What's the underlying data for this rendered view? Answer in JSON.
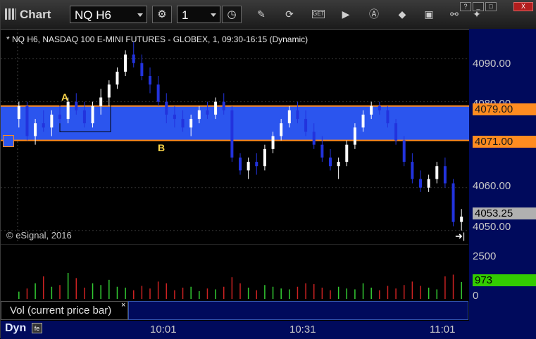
{
  "app": {
    "title": "Chart"
  },
  "toolbar": {
    "symbol": "NQ H6",
    "interval": "1",
    "icons": [
      "cycle-settings-icon",
      "clock-icon",
      "pencil-icon",
      "refresh-icon",
      "get-icon",
      "play-icon",
      "a-circle-icon",
      "tag-icon",
      "frame-icon",
      "link-icon",
      "twitter-icon"
    ],
    "window_controls": [
      "?",
      "_",
      "□",
      "X"
    ]
  },
  "chart": {
    "title": "* NQ H6, NASDAQ 100 E-MINI FUTURES - GLOBEX, 1, 09:30-16:15 (Dynamic)",
    "copyright": "© eSignal, 2016",
    "annotation_a": "A",
    "annotation_b": "B",
    "price_ticks": [
      "4090.00",
      "4080.00",
      "4060.00",
      "4050.00"
    ],
    "upper_band_label": "4079.00",
    "lower_band_label": "4071.00",
    "last_price_label": "4053.25",
    "colors": {
      "band": "#2b55ee",
      "band_edge": "#ff8c20",
      "up": "#ffffff",
      "down": "#2233dd",
      "axis_bg": "#000a5c",
      "orange_tag": "#ff8c20",
      "vol_tag": "#33cc00"
    }
  },
  "volume": {
    "ticks": [
      "2500",
      "0"
    ],
    "current_label": "973",
    "study_tab": "Vol (current price bar)",
    "close_glyph": "×"
  },
  "time_axis": {
    "labels": [
      "10:01",
      "10:31",
      "11:01"
    ],
    "mode_label": "Dyn"
  },
  "chart_data": {
    "type": "candlestick",
    "title": "* NQ H6, NASDAQ 100 E-MINI FUTURES - GLOBEX, 1, 09:30-16:15 (Dynamic)",
    "ylim": [
      4048,
      4096
    ],
    "bands": [
      4071.0,
      4079.0
    ],
    "last_price": 4053.25,
    "ohlc": [
      [
        4076,
        4080,
        4074,
        4079
      ],
      [
        4079,
        4080,
        4071,
        4072
      ],
      [
        4072,
        4076,
        4070,
        4075
      ],
      [
        4075,
        4078,
        4073,
        4074
      ],
      [
        4074,
        4078,
        4072,
        4077
      ],
      [
        4077,
        4079,
        4075,
        4076
      ],
      [
        4076,
        4081,
        4075,
        4080
      ],
      [
        4080,
        4082,
        4077,
        4078
      ],
      [
        4078,
        4080,
        4074,
        4075
      ],
      [
        4075,
        4080,
        4074,
        4079
      ],
      [
        4079,
        4083,
        4077,
        4081
      ],
      [
        4081,
        4085,
        4079,
        4084
      ],
      [
        4084,
        4088,
        4083,
        4087
      ],
      [
        4087,
        4092,
        4086,
        4091
      ],
      [
        4091,
        4094,
        4088,
        4089
      ],
      [
        4089,
        4091,
        4085,
        4086
      ],
      [
        4086,
        4088,
        4082,
        4084
      ],
      [
        4084,
        4086,
        4079,
        4080
      ],
      [
        4080,
        4082,
        4075,
        4077
      ],
      [
        4077,
        4079,
        4074,
        4076
      ],
      [
        4076,
        4078,
        4073,
        4074
      ],
      [
        4074,
        4077,
        4072,
        4076
      ],
      [
        4076,
        4079,
        4075,
        4078
      ],
      [
        4078,
        4080,
        4076,
        4077
      ],
      [
        4077,
        4081,
        4076,
        4080
      ],
      [
        4080,
        4082,
        4077,
        4078
      ],
      [
        4078,
        4079,
        4066,
        4067
      ],
      [
        4067,
        4068,
        4063,
        4064
      ],
      [
        4064,
        4067,
        4062,
        4066
      ],
      [
        4066,
        4068,
        4063,
        4065
      ],
      [
        4065,
        4070,
        4064,
        4069
      ],
      [
        4069,
        4073,
        4068,
        4072
      ],
      [
        4072,
        4076,
        4071,
        4075
      ],
      [
        4075,
        4079,
        4074,
        4078
      ],
      [
        4078,
        4080,
        4075,
        4076
      ],
      [
        4076,
        4078,
        4072,
        4073
      ],
      [
        4073,
        4075,
        4069,
        4070
      ],
      [
        4070,
        4072,
        4066,
        4067
      ],
      [
        4067,
        4069,
        4064,
        4065
      ],
      [
        4065,
        4067,
        4062,
        4066
      ],
      [
        4066,
        4071,
        4065,
        4070
      ],
      [
        4070,
        4075,
        4069,
        4074
      ],
      [
        4074,
        4078,
        4073,
        4077
      ],
      [
        4077,
        4080,
        4076,
        4079
      ],
      [
        4079,
        4080,
        4077,
        4078
      ],
      [
        4078,
        4079,
        4074,
        4075
      ],
      [
        4075,
        4076,
        4070,
        4071
      ],
      [
        4071,
        4072,
        4065,
        4066
      ],
      [
        4066,
        4068,
        4061,
        4062
      ],
      [
        4062,
        4064,
        4059,
        4060
      ],
      [
        4060,
        4063,
        4059,
        4062
      ],
      [
        4062,
        4066,
        4061,
        4065
      ],
      [
        4065,
        4067,
        4060,
        4061
      ],
      [
        4061,
        4062,
        4051,
        4052
      ],
      [
        4052,
        4055,
        4050,
        4053.25
      ]
    ],
    "volume": [
      420,
      600,
      900,
      1300,
      700,
      800,
      1500,
      1200,
      650,
      900,
      800,
      1100,
      700,
      650,
      500,
      750,
      600,
      1000,
      900,
      500,
      650,
      700,
      450,
      600,
      550,
      700,
      1250,
      900,
      650,
      500,
      800,
      700,
      600,
      550,
      700,
      900,
      850,
      650,
      500,
      700,
      600,
      550,
      900,
      650,
      500,
      750,
      600,
      800,
      1000,
      750,
      650,
      550,
      1300,
      1400,
      973
    ]
  }
}
